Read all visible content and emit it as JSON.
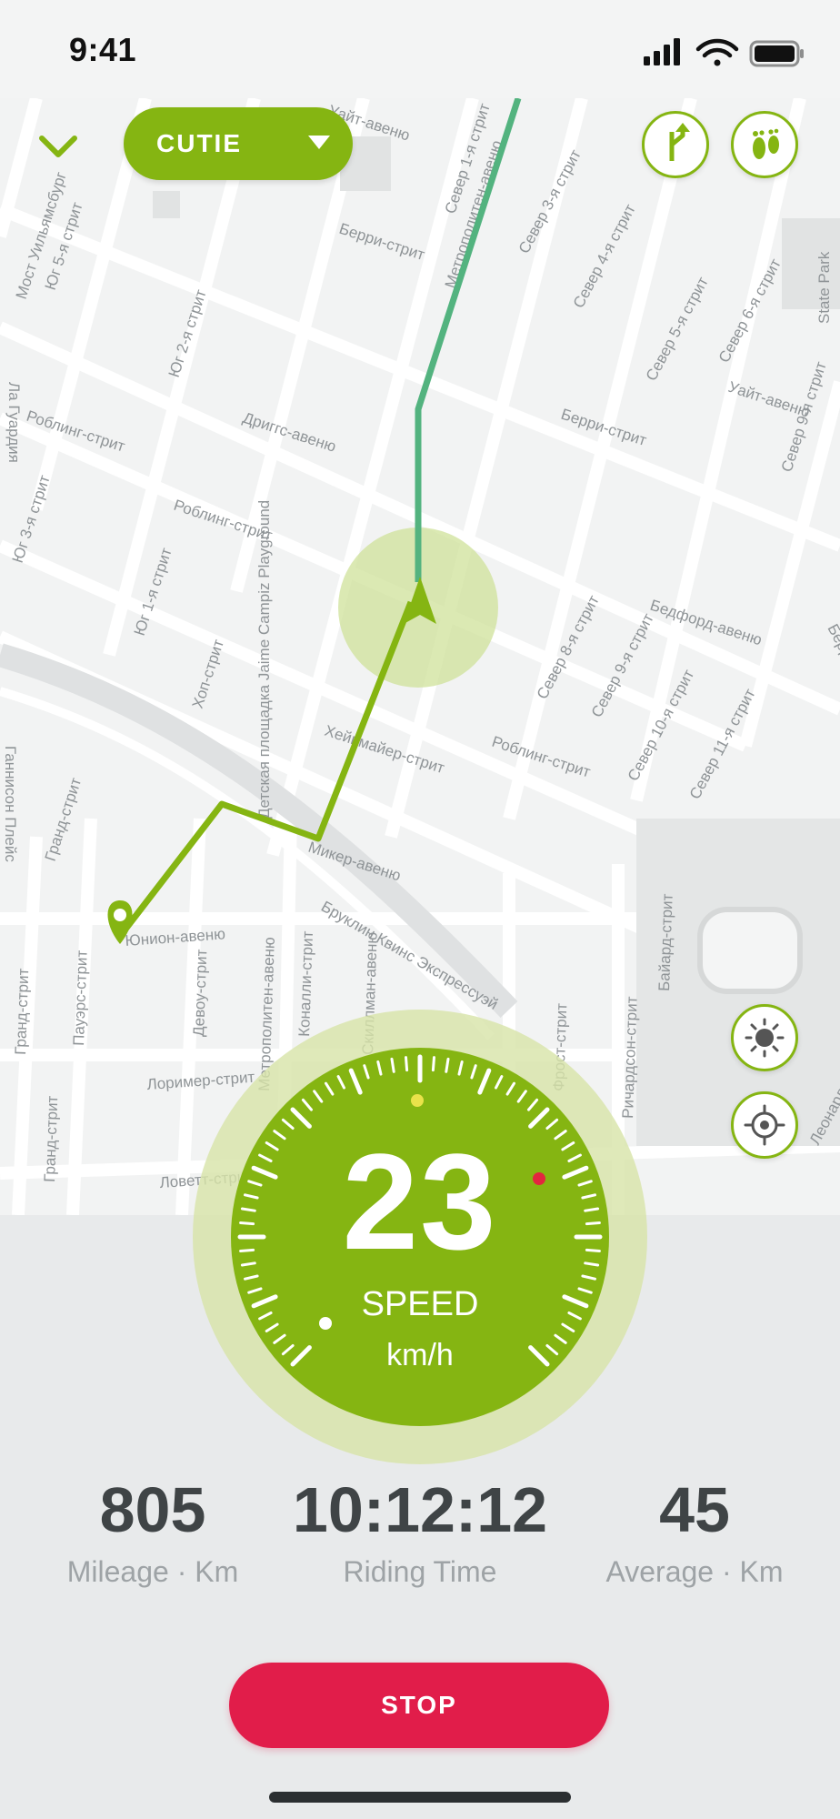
{
  "status_bar": {
    "time": "9:41"
  },
  "header": {
    "profile_label": "CUTIE"
  },
  "map": {
    "street_labels": [
      "Уайт-авеню",
      "Север 1-я стрит",
      "Метрополитен-авеню",
      "Север 3-я стрит",
      "Север 4-я стрит",
      "Север 5-я стрит",
      "Север 6-я стрит",
      "Мост Уильямсбург",
      "Юг 5-я стрит",
      "Берри-стрит",
      "Юг 2-я стрит",
      "Юг 1-я стрит",
      "Роблинг-стрит",
      "Дриггс-авеню",
      "Уайт-авеню",
      "Север 9-я стрит",
      "Берри-стрит",
      "State Park",
      "Юг 3-я стрит",
      "Гранд-стрит",
      "Хоп-стрит",
      "Детская площадка Jaime Campiz Playground",
      "Хейвмайер-стрит",
      "Бедфорд-авеню",
      "Север 8-я стрит",
      "Север 9-я стрит",
      "Север 10-я стрит",
      "Север 11-я стрит",
      "Роблинг-стрит",
      "Микер-авеню",
      "Бруклин Квинс Экспрессуэй",
      "Юнион-авеню",
      "Пауэрс-стрит",
      "Девоу-стрит",
      "Метрополитен-авеню",
      "Коналли-стрит",
      "Скиллман-авеню",
      "Фрост-стрит",
      "Ричардсон-стрит",
      "Байард-стрит",
      "Лоример-стрит",
      "Гранд-стрит",
      "Гранд-стрит",
      "Ловетт-стрит",
      "Леонард-стрит",
      "Роблинг-стрит",
      "Ла Гуардия",
      "Берри-стрит",
      "Ганнисон Плейс"
    ]
  },
  "speedometer": {
    "value": "23",
    "label": "SPEED",
    "unit": "km/h"
  },
  "stats": {
    "mileage": {
      "value": "805",
      "label": "Mileage · Km"
    },
    "riding_time": {
      "value": "10:12:12",
      "label": "Riding Time"
    },
    "average": {
      "value": "45",
      "label": "Average · Km"
    }
  },
  "actions": {
    "stop_label": "STOP"
  },
  "colors": {
    "accent_green": "#85b512",
    "route_teal": "#53b37f",
    "stop_red": "#e11d4a"
  }
}
